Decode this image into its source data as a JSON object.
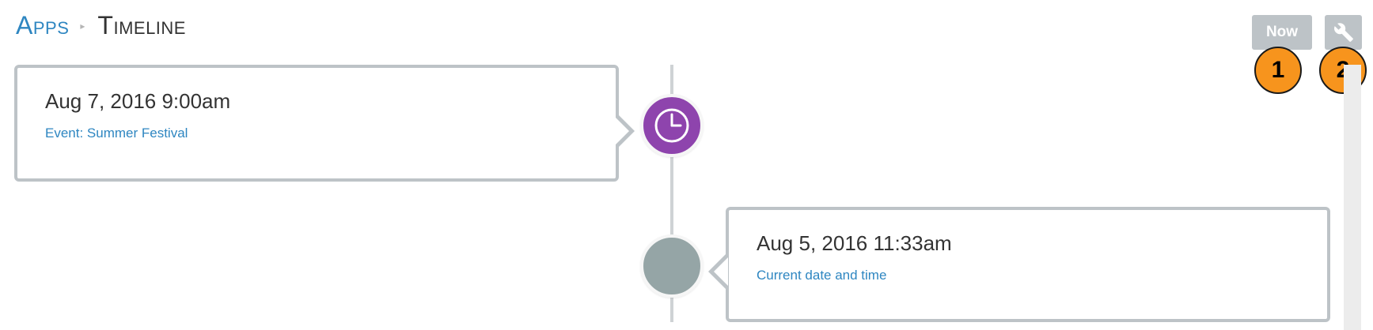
{
  "breadcrumb": {
    "parent_label": "Apps",
    "separator": "▸",
    "current_label": "Timeline"
  },
  "toolbar": {
    "now_label": "Now",
    "settings_icon": "wrench-icon"
  },
  "callouts": [
    "1",
    "2"
  ],
  "timeline": {
    "events": [
      {
        "date": "Aug 7, 2016 9:00am",
        "link_label": "Event: Summer Festival",
        "icon": "clock-icon",
        "node_color": "#8e44ad",
        "side": "left"
      },
      {
        "date": "Aug 5, 2016 11:33am",
        "link_label": "Current date and time",
        "icon": "",
        "node_color": "#95a5a6",
        "side": "right"
      }
    ]
  },
  "colors": {
    "accent": "#2e86c1",
    "button_gray": "#bdc3c7",
    "callout_orange": "#f7941d"
  }
}
